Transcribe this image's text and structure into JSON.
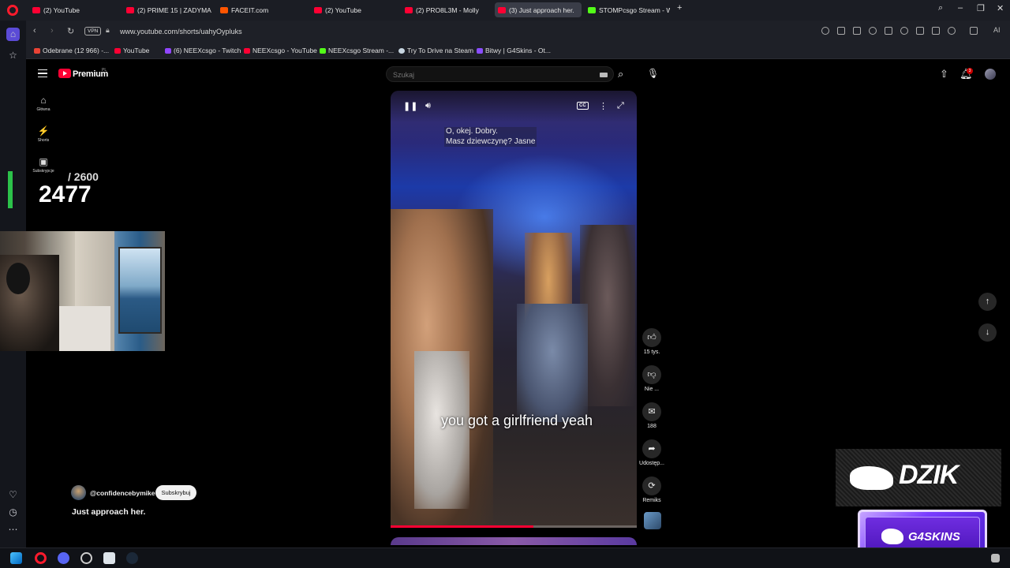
{
  "browser": {
    "tabs": [
      {
        "title": "(2) YouTube",
        "favicon": "youtube-icon"
      },
      {
        "title": "(2) PRIME 15 | ZADYMA +",
        "favicon": "youtube-icon"
      },
      {
        "title": "FACEIT.com",
        "favicon": "faceit-icon"
      },
      {
        "title": "(2) YouTube",
        "favicon": "youtube-icon"
      },
      {
        "title": "(2) PRO8L3M - Molly",
        "favicon": "youtube-icon"
      },
      {
        "title": "(3) Just approach her.",
        "favicon": "youtube-icon",
        "active": true
      },
      {
        "title": "STOMPcsgo Stream - Wat",
        "favicon": "kick-icon"
      }
    ],
    "vpn_label": "VPN",
    "url": "www.youtube.com/shorts/uahyOypluks",
    "bookmarks": [
      "Odebrane (12 966) -...",
      "YouTube",
      "(6) NEEXcsgo - Twitch",
      "NEEXcsgo - YouTube",
      "NEEXcsgo Stream -...",
      "Try To Drive na Steam",
      "Bitwy | G4Skins - Ot..."
    ],
    "sidebar_ai_label": "AI"
  },
  "youtube": {
    "logo_label": "Premium",
    "region": "PL",
    "search_placeholder": "Szukaj",
    "notification_count": "3",
    "nav": [
      {
        "label": "Główna",
        "icon": "home-icon"
      },
      {
        "label": "Shorts",
        "icon": "shorts-icon"
      },
      {
        "label": "Subskrypcje",
        "icon": "subscriptions-icon"
      }
    ]
  },
  "overlay": {
    "counter_value": "2477",
    "counter_goal": "/ 2600"
  },
  "video": {
    "caption_top_line1": "O, okej.  Dobry.",
    "caption_top_line2": "Masz dziewczynę?  Jasne",
    "caption_bottom": "you got a girlfriend yeah",
    "progress": 0.58,
    "actions": {
      "like_count": "15 tys.",
      "dislike_label": "Nie ...",
      "comment_count": "188",
      "share_label": "Udostęp...",
      "remix_label": "Remiks"
    },
    "channel": "@confidencebymike",
    "subscribe_label": "Subskrybuj",
    "title": "Just approach her."
  },
  "sponsors": {
    "primary": "DZIK",
    "secondary": "G4SKINS"
  },
  "colors": {
    "youtube_red": "#ff0033",
    "opera_red": "#ff1b2d",
    "counter_green": "#2cc24a",
    "g4skins_purple": "#7a3cff"
  }
}
